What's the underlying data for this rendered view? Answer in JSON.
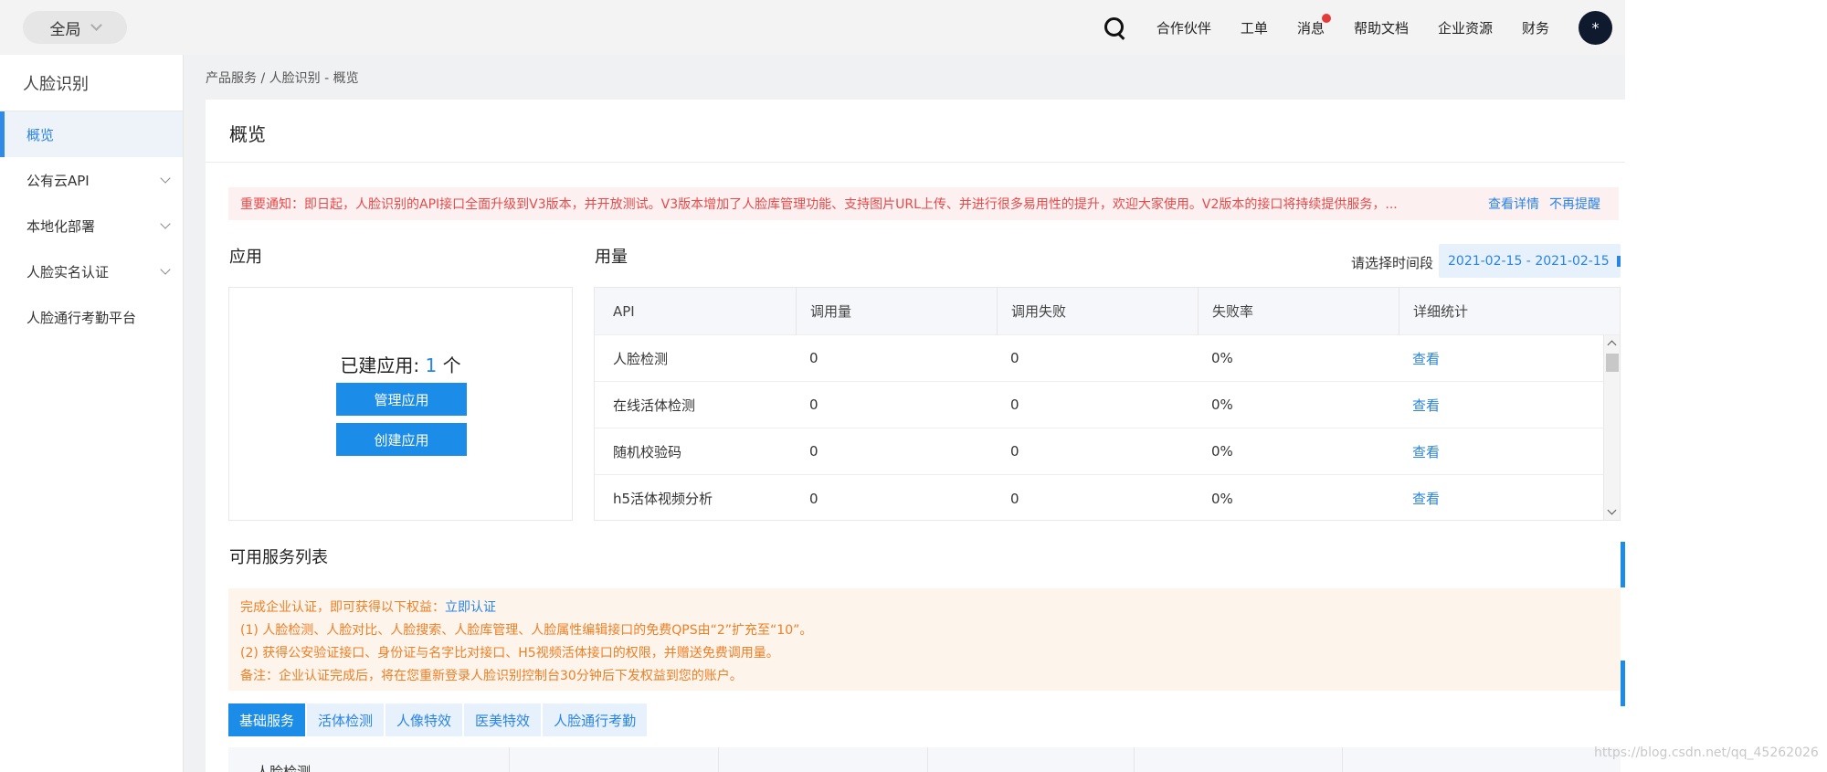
{
  "topbar": {
    "scope_label": "全局",
    "nav": [
      "合作伙伴",
      "工单",
      "消息",
      "帮助文档",
      "企业资源",
      "财务"
    ],
    "avatar_text": "*"
  },
  "sidebar": {
    "title": "人脸识别",
    "items": [
      {
        "label": "概览",
        "active": true,
        "expandable": false
      },
      {
        "label": "公有云API",
        "active": false,
        "expandable": true
      },
      {
        "label": "本地化部署",
        "active": false,
        "expandable": true
      },
      {
        "label": "人脸实名认证",
        "active": false,
        "expandable": true
      },
      {
        "label": "人脸通行考勤平台",
        "active": false,
        "expandable": false
      }
    ]
  },
  "breadcrumb": "产品服务  /  人脸识别 - 概览",
  "page_title": "概览",
  "notice": {
    "text": "重要通知：即日起，人脸识别的API接口全面升级到V3版本，并开放测试。V3版本增加了人脸库管理功能、支持图片URL上传、并进行很多易用性的提升，欢迎大家使用。V2版本的接口将持续提供服务，...",
    "detail_link": "查看详情",
    "dismiss_link": "不再提醒"
  },
  "apps": {
    "title": "应用",
    "count_prefix": "已建应用: ",
    "count": "1",
    "count_suffix": " 个",
    "manage_button": "管理应用",
    "create_button": "创建应用"
  },
  "usage": {
    "title": "用量",
    "date_label": "请选择时间段",
    "date_range": "2021-02-15 - 2021-02-15",
    "columns": [
      "API",
      "调用量",
      "调用失败",
      "失败率",
      "详细统计"
    ],
    "rows": [
      {
        "api": "人脸检测",
        "calls": "0",
        "fails": "0",
        "rate": "0%",
        "detail": "查看"
      },
      {
        "api": "在线活体检测",
        "calls": "0",
        "fails": "0",
        "rate": "0%",
        "detail": "查看"
      },
      {
        "api": "随机校验码",
        "calls": "0",
        "fails": "0",
        "rate": "0%",
        "detail": "查看"
      },
      {
        "api": "h5活体视频分析",
        "calls": "0",
        "fails": "0",
        "rate": "0%",
        "detail": "查看"
      }
    ]
  },
  "services": {
    "title": "可用服务列表",
    "benefit_intro": "完成企业认证，即可获得以下权益：",
    "benefit_link": "立即认证",
    "benefit_lines": [
      "(1) 人脸检测、人脸对比、人脸搜索、人脸库管理、人脸属性编辑接口的免费QPS由“2”扩充至“10”。",
      "(2) 获得公安验证接口、身份证与名字比对接口、H5视频活体接口的权限，并赠送免费调用量。",
      "备注：企业认证完成后，将在您重新登录人脸识别控制台30分钟后下发权益到您的账户。"
    ],
    "tabs": [
      "基础服务",
      "活体检测",
      "人像特效",
      "医美特效",
      "人脸通行考勤"
    ],
    "first_column_header": "人脸检测"
  },
  "watermark": "https://blog.csdn.net/qq_45262026",
  "colors": {
    "accent": "#1b8ce8",
    "link": "#2a84e3",
    "notice_red": "#e64a4a",
    "benefit_orange": "#ee7f25"
  }
}
